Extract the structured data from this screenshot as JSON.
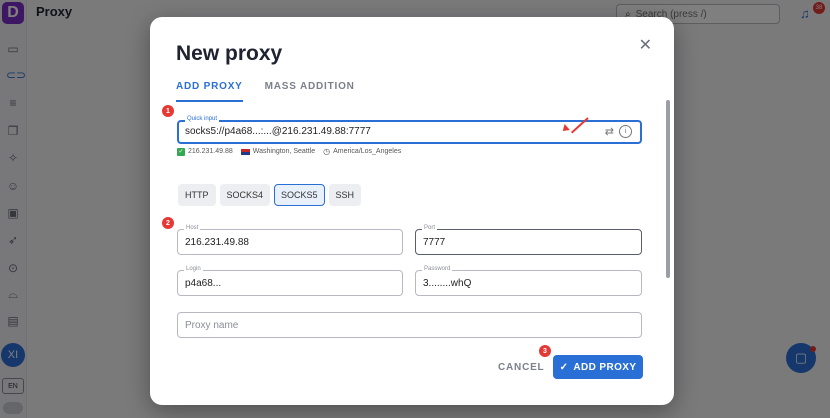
{
  "app": {
    "logo_letter": "D",
    "page_title": "Proxy",
    "search_placeholder": "Search (press /)",
    "notification_count": "38",
    "avatar_initials": "XI",
    "language": "EN"
  },
  "modal": {
    "title": "New proxy",
    "close_icon": "close-icon",
    "tabs": [
      {
        "label": "ADD PROXY",
        "active": true
      },
      {
        "label": "MASS ADDITION",
        "active": false
      }
    ],
    "quick_input": {
      "label": "Quick input",
      "value": "socks5://p4a68...:...@216.231.49.88:7777"
    },
    "geo": {
      "ip": "216.231.49.88",
      "location": "Washington, Seattle",
      "timezone": "America/Los_Angeles"
    },
    "protocols": [
      {
        "label": "HTTP",
        "active": false
      },
      {
        "label": "SOCKS4",
        "active": false
      },
      {
        "label": "SOCKS5",
        "active": true
      },
      {
        "label": "SSH",
        "active": false
      }
    ],
    "host": {
      "label": "Host",
      "value": "216.231.49.88"
    },
    "port": {
      "label": "Port",
      "value": "7777"
    },
    "login": {
      "label": "Login",
      "value": "p4a68..."
    },
    "password": {
      "label": "Password",
      "value": "3........whQ"
    },
    "proxy_name": {
      "placeholder": "Proxy name"
    },
    "cancel_label": "CANCEL",
    "add_label": "ADD PROXY",
    "steps": [
      "1",
      "2",
      "3"
    ]
  },
  "colors": {
    "accent": "#2a6fd6",
    "annotation": "#e53935",
    "success": "#34a853"
  }
}
